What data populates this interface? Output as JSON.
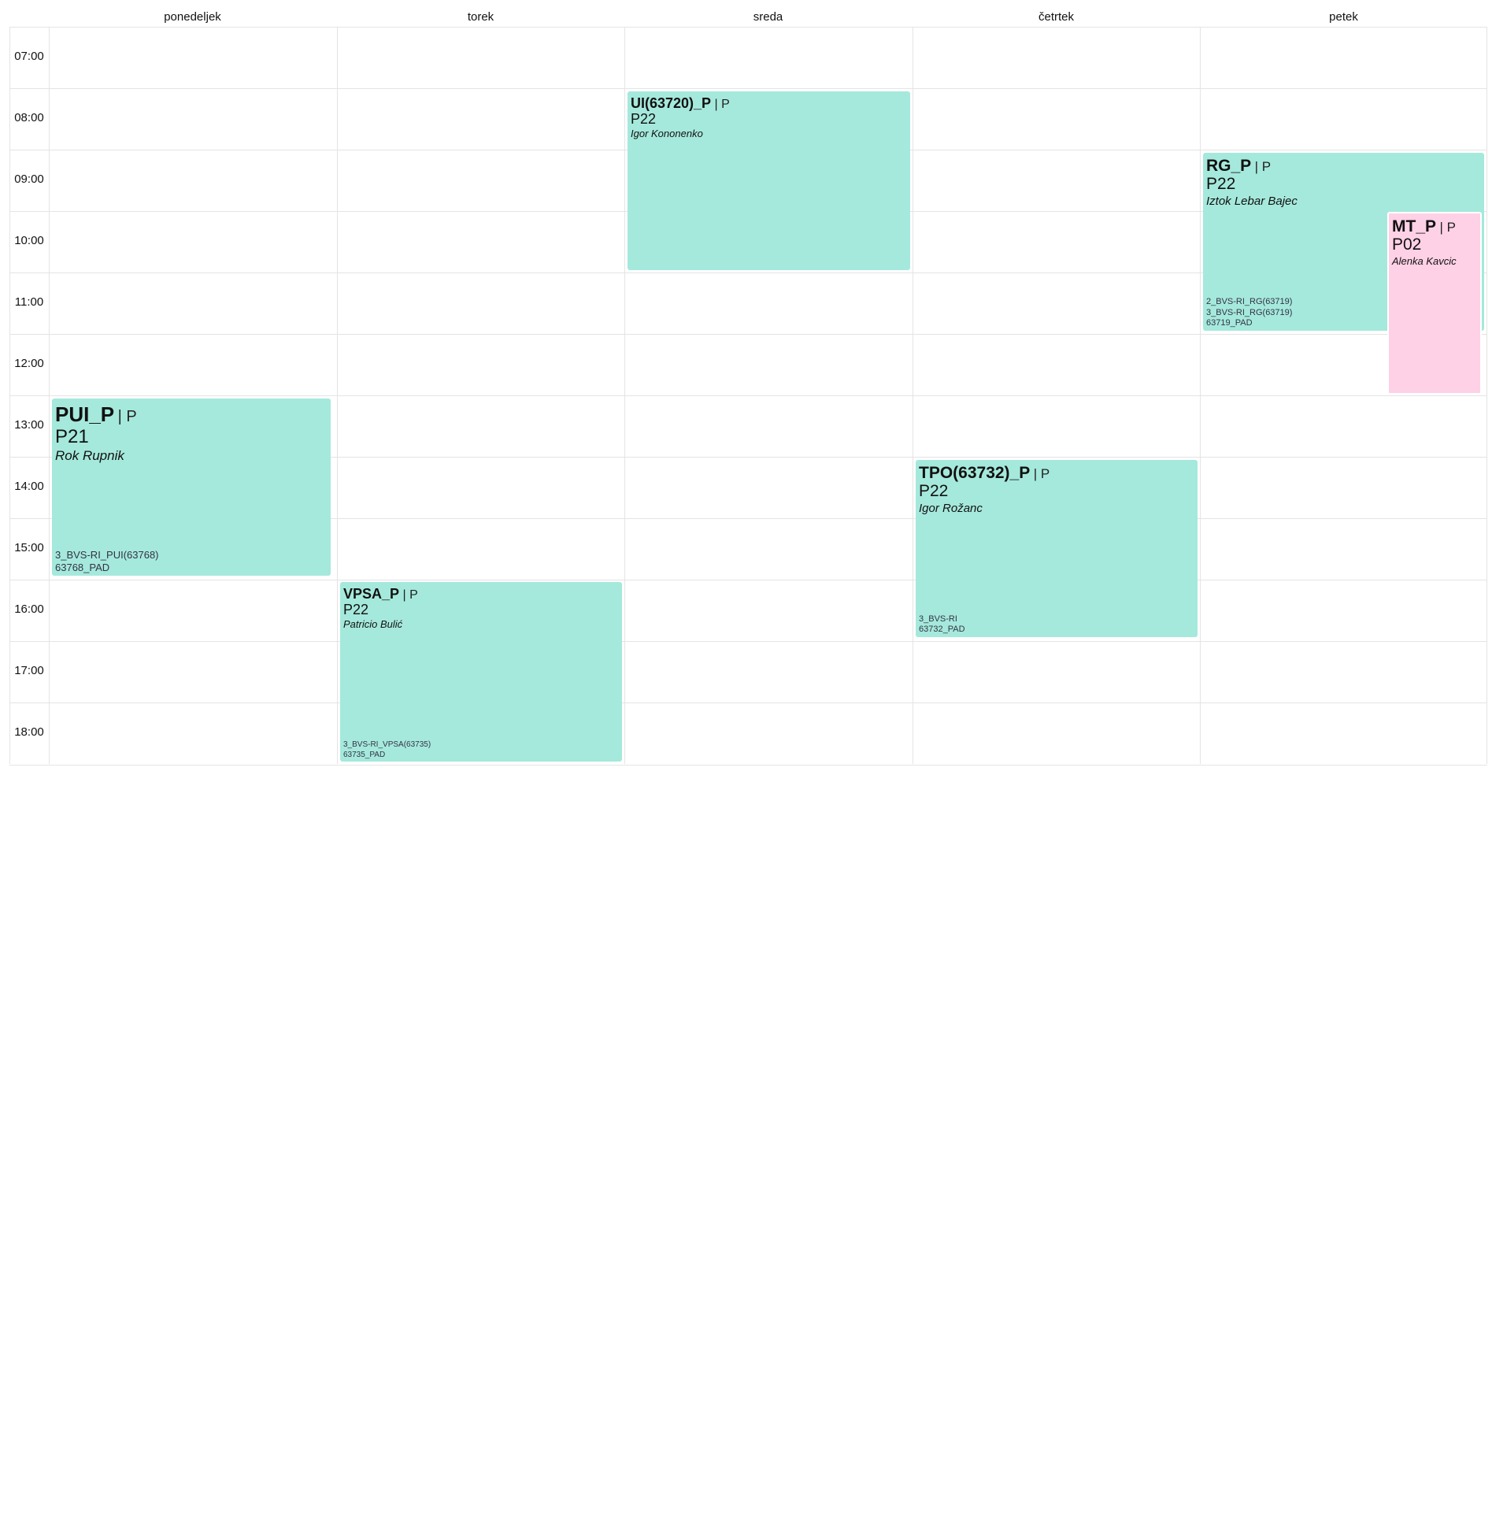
{
  "days": [
    "ponedeljek",
    "torek",
    "sreda",
    "četrtek",
    "petek"
  ],
  "hours": [
    "07:00",
    "08:00",
    "09:00",
    "10:00",
    "11:00",
    "12:00",
    "13:00",
    "14:00",
    "15:00",
    "16:00",
    "17:00",
    "18:00"
  ],
  "colors": {
    "lecture": "#a5e9dc",
    "other_lecture": "#ffd1e6",
    "grid_line": "#e4e4e4"
  },
  "events": [
    {
      "title": "PUI_P",
      "type": "| P",
      "room": "P21",
      "teacher": "Rok Rupnik",
      "groups": [
        "3_BVS-RI_PUI(63768)",
        "63768_PAD"
      ],
      "day": "ponedeljek",
      "start": "13:00",
      "end": "16:00"
    },
    {
      "title": "VPSA_P",
      "type": "| P",
      "room": "P22",
      "teacher": "Patricio Bulić",
      "groups": [
        "3_BVS-RI_VPSA(63735)",
        "63735_PAD"
      ],
      "day": "torek",
      "start": "16:00",
      "end": "19:00"
    },
    {
      "title": "UI(63720)_P",
      "type": "| P",
      "room": "P22",
      "teacher": "Igor Kononenko",
      "groups": [],
      "day": "sreda",
      "start": "08:00",
      "end": "11:00"
    },
    {
      "title": "TPO(63732)_P",
      "type": "| P",
      "room": "P22",
      "teacher": "Igor Rožanc",
      "groups": [
        "3_BVS-RI",
        "63732_PAD"
      ],
      "day": "četrtek",
      "start": "14:00",
      "end": "17:00"
    },
    {
      "title": "RG_P",
      "type": "| P",
      "room": "P22",
      "teacher": "Iztok Lebar Bajec",
      "groups": [
        "2_BVS-RI_RG(63719)",
        "3_BVS-RI_RG(63719)",
        "63719_PAD"
      ],
      "day": "petek",
      "start": "09:00",
      "end": "12:00"
    },
    {
      "title": "MT_P",
      "type": "| P",
      "room": "P02",
      "teacher": "Alenka Kavcic",
      "groups": [],
      "day": "petek",
      "start": "10:00",
      "end": "13:00"
    }
  ]
}
